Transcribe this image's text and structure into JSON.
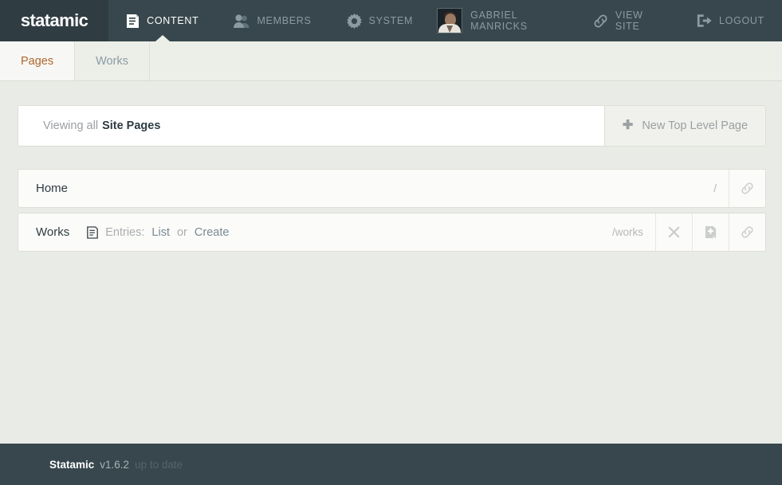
{
  "header": {
    "logo": "statamic",
    "nav": [
      {
        "label": "CONTENT",
        "icon": "document-icon",
        "active": true
      },
      {
        "label": "MEMBERS",
        "icon": "users-icon",
        "active": false
      },
      {
        "label": "SYSTEM",
        "icon": "gear-icon",
        "active": false
      }
    ],
    "user": {
      "name": "GABRIEL MANRICKS",
      "avatar_alt": "user-avatar"
    },
    "view_site": {
      "label": "VIEW SITE",
      "icon": "link-icon"
    },
    "logout": {
      "label": "LOGOUT",
      "icon": "logout-icon"
    }
  },
  "subnav": {
    "tabs": [
      {
        "label": "Pages",
        "active": true
      },
      {
        "label": "Works",
        "active": false
      }
    ]
  },
  "toolbar": {
    "viewing_prefix": "Viewing all",
    "viewing_target": "Site Pages",
    "new_page_label": "New Top Level Page",
    "plus_glyph": "✚"
  },
  "pages": [
    {
      "title": "Home",
      "url": "/",
      "entries": null,
      "actions": [
        "link-icon"
      ]
    },
    {
      "title": "Works",
      "url": "/works",
      "entries": {
        "icon": "entries-document-icon",
        "prefix": "Entries:",
        "list_label": "List",
        "separator": "or",
        "create_label": "Create"
      },
      "actions": [
        "delete-icon",
        "new-subpage-icon",
        "link-icon"
      ]
    }
  ],
  "footer": {
    "name": "Statamic",
    "version": "v1.6.2",
    "status": "up to date"
  },
  "colors": {
    "header_bg": "#37474d",
    "logo_bg": "#2f3d42",
    "page_bg": "#e9ebe6",
    "active_tab": "#b0642a",
    "card_bg": "#ffffff",
    "link": "#7b8a94"
  }
}
